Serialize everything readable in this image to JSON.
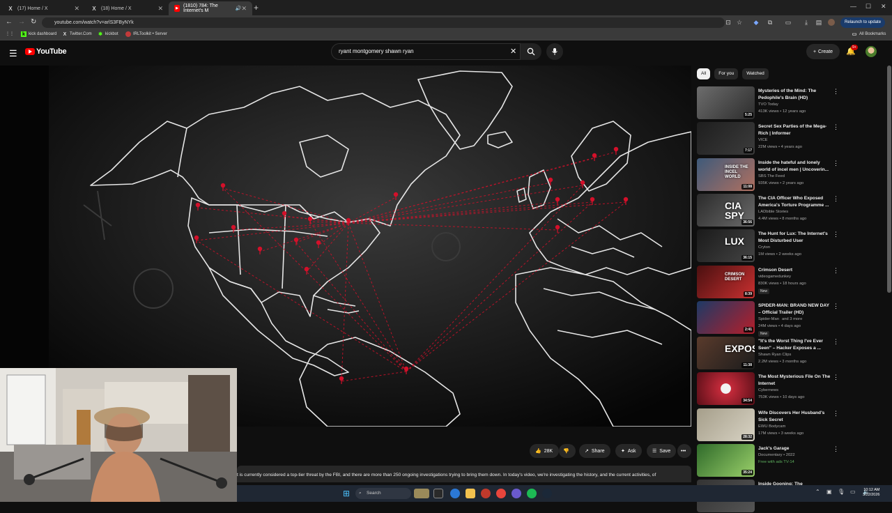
{
  "browser": {
    "tabs": [
      {
        "label": "(17) Home / X",
        "icon": "x-logo-icon"
      },
      {
        "label": "(18) Home / X",
        "icon": "x-logo-icon"
      },
      {
        "label": "(1810) 784: The Internet's M",
        "icon": "youtube-icon",
        "active": true
      }
    ],
    "url": "youtube.com/watch?v=arlS3FByNYk",
    "relaunch_label": "Relaunch to update",
    "bookmarks": [
      {
        "label": "kick dashboard"
      },
      {
        "label": "Twitter.Com"
      },
      {
        "label": "kickbot"
      },
      {
        "label": "IRLToolkit • Server"
      }
    ],
    "all_bookmarks": "All Bookmarks"
  },
  "youtube": {
    "logo_text": "YouTube",
    "search_query": "ryant montgomery shawn ryan",
    "create_label": "Create",
    "notif_count": "9+"
  },
  "video_actions": {
    "likes": "28K",
    "share": "Share",
    "ask": "Ask",
    "save": "Save"
  },
  "description": "t is currently considered a top-tier threat by the FBI, and there are more than 250 ongoing investigations trying to bring them down. In today's video, we're investigating the history, and the current activities, of",
  "sidebar": {
    "chips": [
      "All",
      "For you",
      "Watched"
    ],
    "recommendations": [
      {
        "title": "Mysteries of the Mind: The Pedophile's Brain (HD)",
        "channel": "TVO Today",
        "meta": "413K views • 12 years ago",
        "duration": "5:25",
        "thumb_text": "",
        "new": ""
      },
      {
        "title": "Secret Sex Parties of the Mega-Rich | Informer",
        "channel": "VICE",
        "meta": "22M views • 4 years ago",
        "duration": "7:17",
        "thumb_text": "",
        "new": ""
      },
      {
        "title": "Inside the hateful and lonely world of incel men | Uncoverin...",
        "channel": "SBS The Feed",
        "meta": "935K views • 2 years ago",
        "duration": "11:08",
        "thumb_text": "INSIDE THE INCEL WORLD",
        "new": ""
      },
      {
        "title": "The CIA Officer Who Exposed America's Torture Programme ...",
        "channel": "LADbible Stories",
        "meta": "4.4M views • 8 months ago",
        "duration": "36:56",
        "thumb_text": "CIA SPY",
        "new": ""
      },
      {
        "title": "The Hunt for Lux: The Internet's Most Disturbed User",
        "channel": "Cryton",
        "meta": "1M views • 2 weeks ago",
        "duration": "36:15",
        "thumb_text": "LUX",
        "new": ""
      },
      {
        "title": "Crimson Desert",
        "channel": "videogamedunkey",
        "meta": "830K views • 18 hours ago",
        "duration": "8:39",
        "thumb_text": "CRIMSON DESERT",
        "new": "New"
      },
      {
        "title": "SPIDER-MAN: BRAND NEW DAY – Official Trailer (HD)",
        "channel": "Spider-Man",
        "meta": "24M views • 4 days ago",
        "duration": "2:41",
        "thumb_text": "",
        "new": "New",
        "channel_extra": "and 3 more"
      },
      {
        "title": "\"It's the Worst Thing I've Ever Seen\" – Hacker Exposes a ...",
        "channel": "Shawn Ryan Clips",
        "meta": "2.2M views • 3 months ago",
        "duration": "11:38",
        "thumb_text": "EXPOSING",
        "new": ""
      },
      {
        "title": "The Most Mysterious File On The Internet",
        "channel": "Cybernews",
        "meta": "753K views • 10 days ago",
        "duration": "34:54",
        "thumb_text": "",
        "new": ""
      },
      {
        "title": "Wife Discovers Her Husband's Sick Secret",
        "channel": "EWU Bodycam",
        "meta": "17M views • 3 weeks ago",
        "duration": "28:32",
        "thumb_text": "",
        "new": ""
      },
      {
        "title": "Jack's Garage",
        "channel": "Documentary • 2022",
        "meta": "Free with ads  TV-14",
        "duration": "35:24",
        "thumb_text": "",
        "new": ""
      },
      {
        "title": "Inside Gooning: The",
        "channel": "",
        "meta": "",
        "duration": "",
        "thumb_text": "",
        "new": ""
      }
    ]
  },
  "taskbar": {
    "search_label": "Search",
    "time": "10:12 AM",
    "date": "3/22/2026"
  },
  "colors": {
    "youtube_red": "#ff0000",
    "map_lines": "#e6e6e6",
    "map_pins": "#d4102a",
    "background": "#0f0f0f"
  }
}
